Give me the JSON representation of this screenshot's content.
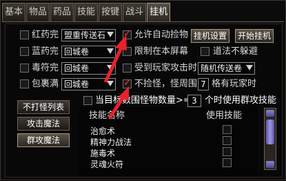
{
  "tabs": [
    "基本",
    "物品",
    "药品",
    "技能",
    "按键",
    "战斗",
    "挂机"
  ],
  "rows": [
    {
      "label": "红药完",
      "select": "盟重传送石"
    },
    {
      "label": "蓝药完",
      "select": "回城卷"
    },
    {
      "label": "毒符完",
      "select": "回城卷"
    },
    {
      "label": "包裹满",
      "select": "回城卷"
    }
  ],
  "options": {
    "auto_pickup": "允许自动捡物",
    "limit_screen": "限制在本屏幕",
    "taoist_no_dodge": "道法不躲避",
    "attacked_by_player": "受到玩家攻击时",
    "attacked_action": "随机传送卷",
    "no_monster_prefix": "不捡怪，怪周围",
    "no_monster_range": "7",
    "no_monster_suffix": "格有玩家时",
    "monster_count_prefix": "当目标数围怪物数量>=",
    "monster_count_value": "3",
    "monster_count_suffix": "个时使用群攻技能"
  },
  "buttons": {
    "settings": "挂机设置",
    "start": "开始挂机",
    "no_attack_list": "不打怪列表",
    "attack_magic": "攻击魔法",
    "group_magic": "群攻魔法"
  },
  "skill_table": {
    "header_name": "技能名称",
    "header_use": "使用技能",
    "skills": [
      "治愈术",
      "精神力战法",
      "施毒术",
      "灵魂火符"
    ]
  },
  "colors": {
    "check": "#ff2a2a",
    "annotation_arrow": "#e8222a"
  }
}
